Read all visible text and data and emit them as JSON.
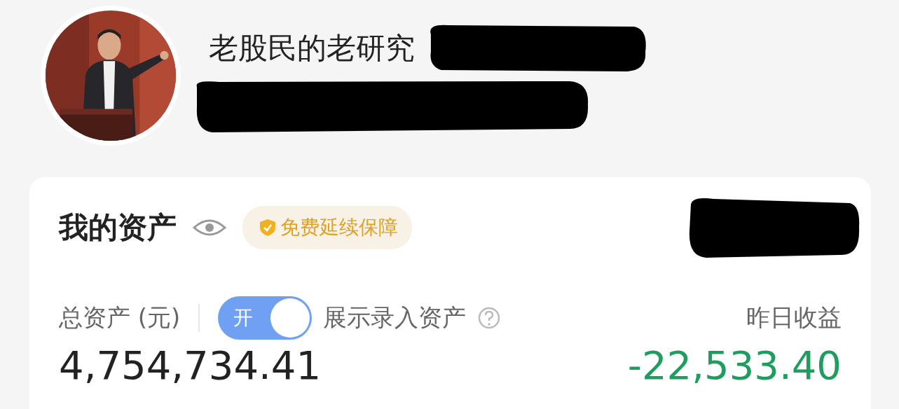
{
  "profile": {
    "name": "老股民的老研究"
  },
  "assets": {
    "title": "我的资产",
    "badge": "免费延续保障",
    "total_label": "总资产 (元)",
    "toggle": {
      "label": "开",
      "on": true
    },
    "toggle_caption": "展示录入资产",
    "yesterday_label": "昨日收益",
    "total_value": "4,754,734.41",
    "yesterday_value": "-22,533.40"
  }
}
